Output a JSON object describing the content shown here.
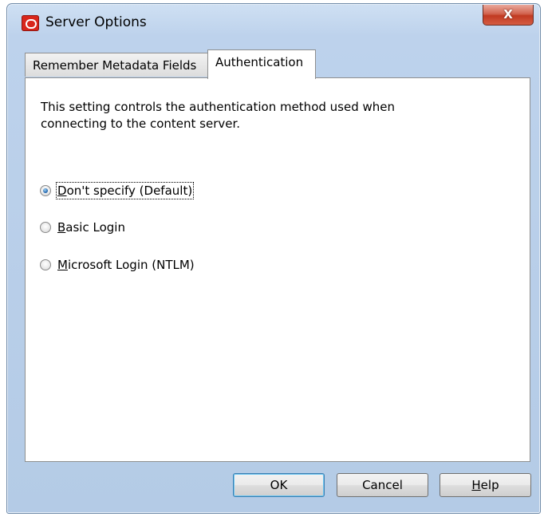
{
  "window": {
    "title": "Server Options",
    "close_label": "X"
  },
  "tabs": [
    {
      "label": "Remember Metadata Fields",
      "selected": false
    },
    {
      "label": "Authentication",
      "selected": true
    }
  ],
  "panel": {
    "description": "This setting controls the authentication method used when connecting to the content server.",
    "options": [
      {
        "first": "D",
        "rest": "on't specify (Default)",
        "checked": true
      },
      {
        "first": "B",
        "rest": "asic Login",
        "checked": false
      },
      {
        "first": "M",
        "rest": "icrosoft Login (NTLM)",
        "checked": false
      }
    ]
  },
  "buttons": {
    "ok": "OK",
    "cancel": "Cancel",
    "help_first": "H",
    "help_rest": "elp"
  }
}
